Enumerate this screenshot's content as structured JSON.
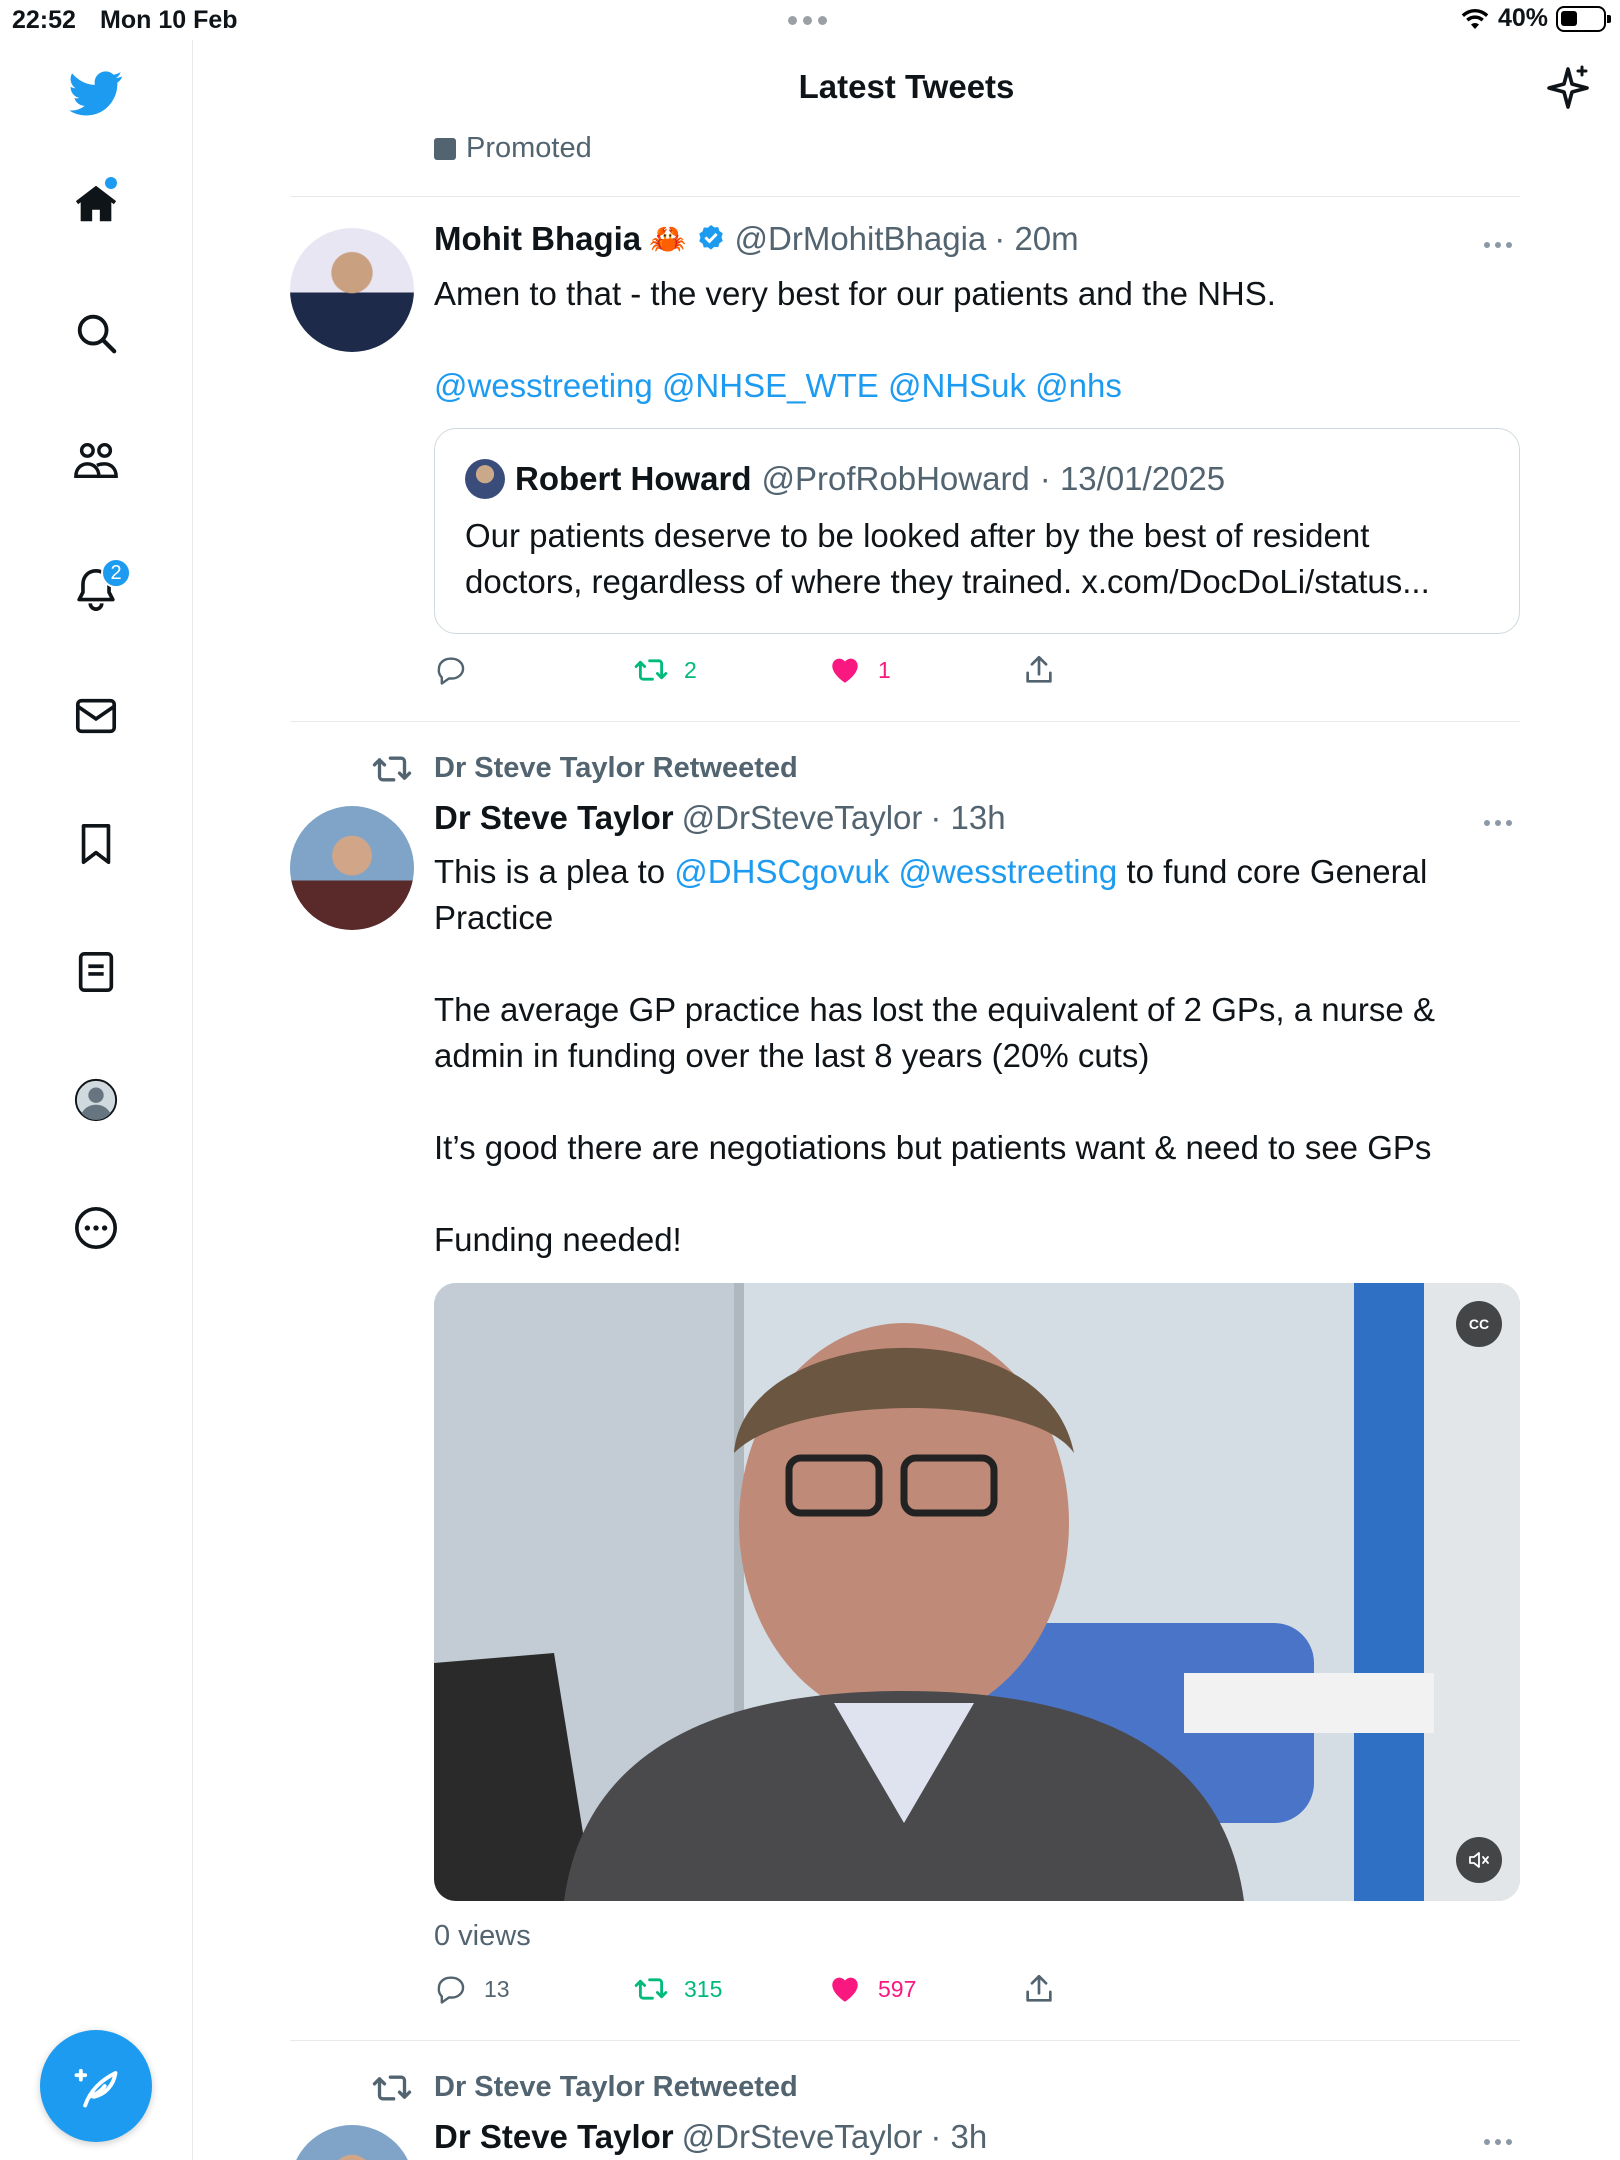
{
  "status_bar": {
    "time": "22:52",
    "date": "Mon 10 Feb",
    "battery": "40%"
  },
  "header": {
    "title": "Latest Tweets"
  },
  "sidebar": {
    "notifications_badge": "2"
  },
  "feed": {
    "promoted_label": "Promoted",
    "tweets": [
      {
        "name": "Mohit Bhagia",
        "emoji": "🦀",
        "handle": "@DrMohitBhagia",
        "time": "· 20m",
        "text": "Amen to that - the very best for our patients and the NHS.",
        "mentions": [
          "@wesstreeting",
          "@NHSE_WTE",
          "@NHSuk",
          "@nhs"
        ],
        "quote": {
          "name": "Robert Howard",
          "handle": "@ProfRobHoward",
          "date": "· 13/01/2025",
          "text_line1": "Our patients deserve to be looked after by the best of resident",
          "text_line2": "doctors, regardless of where they trained. x.com/DocDoLi/status..."
        },
        "replies": "",
        "retweets": "2",
        "likes": "1"
      },
      {
        "retweeted_by": "Dr Steve Taylor Retweeted",
        "name": "Dr Steve Taylor",
        "handle": "@DrSteveTaylor",
        "time": "· 13h",
        "text_p1_start": "This is a plea to ",
        "mention1": "@DHSCgovuk",
        "mention2": "@wesstreeting",
        "text_p1_end": " to fund core General",
        "text_p1_line2": "Practice",
        "text_p2_line1": "The average GP practice has lost the equivalent of 2 GPs, a nurse &",
        "text_p2_line2": "admin in funding over the last 8 years (20% cuts)",
        "text_p3": "It’s good there are negotiations but patients want & need to see GPs",
        "text_p4": "Funding needed!",
        "video_cc": "CC",
        "views": "0 views",
        "replies": "13",
        "retweets": "315",
        "likes": "597"
      },
      {
        "retweeted_by": "Dr Steve Taylor Retweeted",
        "name": "Dr Steve Taylor",
        "handle": "@DrSteveTaylor",
        "time": "· 3h"
      }
    ]
  },
  "colors": {
    "brand": "#1d9bf0",
    "retweet": "#00ba7c",
    "like": "#f91880",
    "muted": "#536471"
  }
}
